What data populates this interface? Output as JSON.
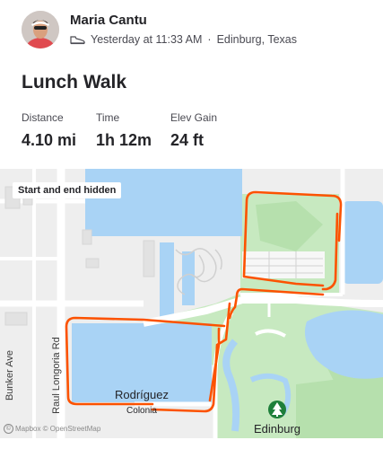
{
  "header": {
    "athlete_name": "Maria Cantu",
    "activity_time": "Yesterday at 11:33 AM",
    "separator": "·",
    "location": "Edinburg, Texas",
    "activity_icon": "shoe-icon"
  },
  "activity": {
    "title": "Lunch Walk"
  },
  "stats": [
    {
      "label": "Distance",
      "value": "4.10 mi"
    },
    {
      "label": "Time",
      "value": "1h 12m"
    },
    {
      "label": "Elev Gain",
      "value": "24 ft"
    }
  ],
  "map": {
    "hidden_badge": "Start and end hidden",
    "labels": {
      "bunker_ave": "Bunker Ave",
      "raul_longoria": "Raul Longoria Rd",
      "rodriguez_1": "Rodríguez",
      "rodriguez_2": "Colonia",
      "edinburg": "Edinburg"
    },
    "attribution": "Mapbox © OpenStreetMap",
    "colors": {
      "route": "#fc5200",
      "water": "#a9d3f5",
      "park": "#c7e9c0",
      "park_dark": "#b6e0ad",
      "land": "#eeeeee",
      "road": "#ffffff"
    }
  }
}
